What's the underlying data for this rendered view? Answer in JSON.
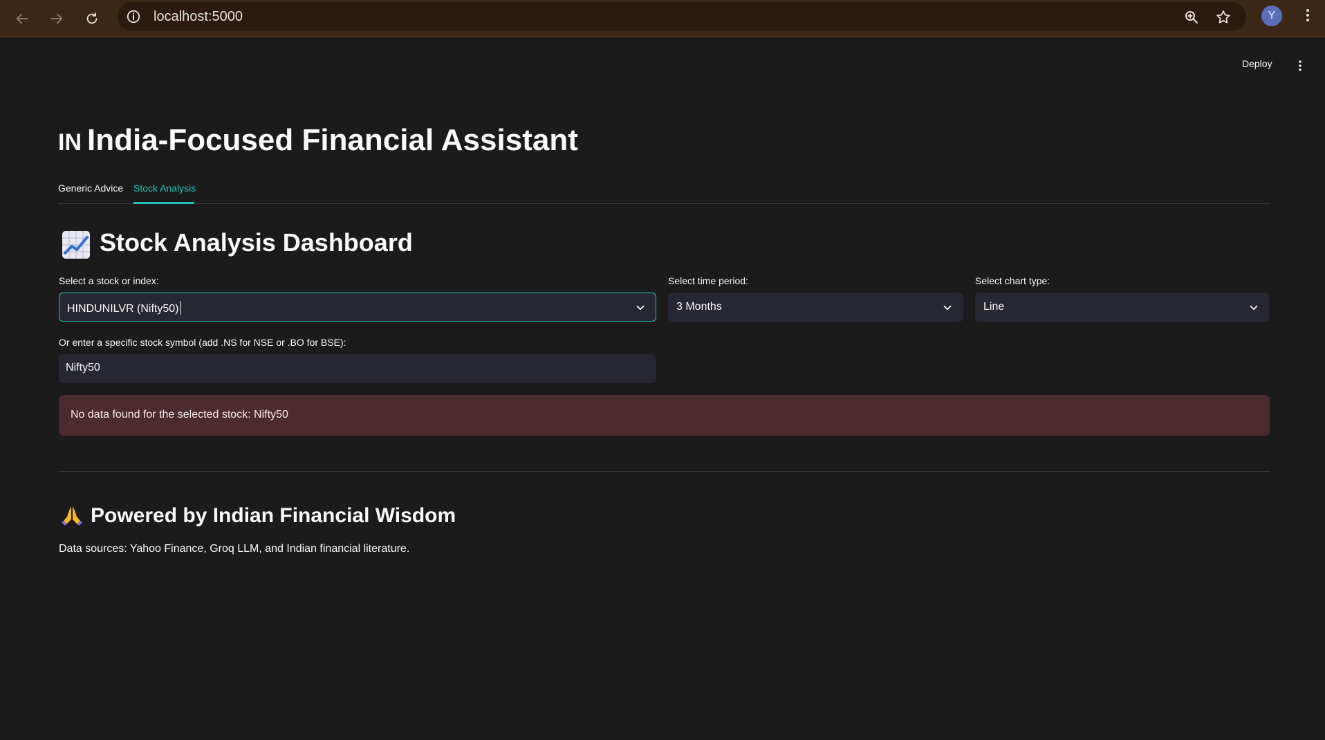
{
  "browser": {
    "url": "localhost:5000",
    "avatar_initial": "Y",
    "icons": [
      "back-icon",
      "forward-icon",
      "reload-icon",
      "site-info-icon",
      "zoom-icon",
      "bookmark-star-icon",
      "chrome-menu-icon"
    ]
  },
  "app_header": {
    "deploy_label": "Deploy",
    "menu_icon": "kebab-menu-icon"
  },
  "page": {
    "flag_text": "IN",
    "title": "India-Focused Financial Assistant"
  },
  "tabs": [
    {
      "label": "Generic Advice",
      "active": false
    },
    {
      "label": "Stock Analysis",
      "active": true
    }
  ],
  "dashboard": {
    "icon": "chart-increasing-icon",
    "title": "Stock Analysis Dashboard"
  },
  "form": {
    "stock_select": {
      "label": "Select a stock or index:",
      "value": "HINDUNILVR (Nifty50)"
    },
    "period_select": {
      "label": "Select time period:",
      "value": "3 Months"
    },
    "chart_select": {
      "label": "Select chart type:",
      "value": "Line"
    },
    "symbol_input": {
      "label": "Or enter a specific stock symbol (add .NS for NSE or .BO for BSE):",
      "value": "Nifty50"
    }
  },
  "alert": {
    "message": "No data found for the selected stock: Nifty50"
  },
  "footer": {
    "icon": "folded-hands-icon",
    "title": "Powered by Indian Financial Wisdom",
    "sources": "Data sources: Yahoo Finance, Groq LLM, and Indian financial literature."
  },
  "colors": {
    "background": "#1b1b1b",
    "accent": "#22c3b6",
    "input_bg": "#262730",
    "error_bg": "#4b2b30",
    "browser_bar": "#3a2715"
  }
}
